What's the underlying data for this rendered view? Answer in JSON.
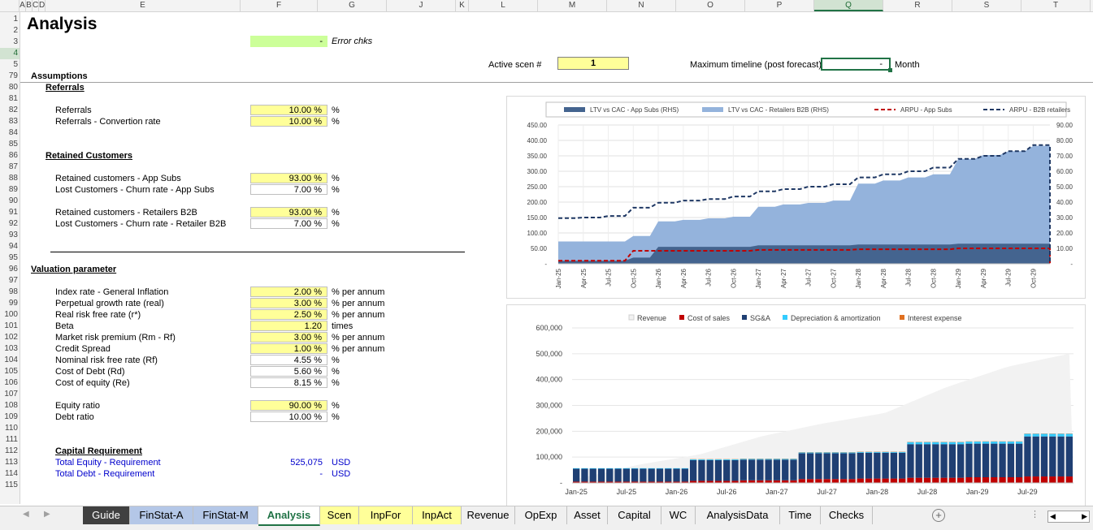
{
  "columns": [
    {
      "label": "A"
    },
    {
      "label": "B"
    },
    {
      "label": "C"
    },
    {
      "label": "D"
    },
    {
      "label": "E"
    },
    {
      "label": "F"
    },
    {
      "label": "G"
    },
    {
      "label": "J"
    },
    {
      "label": "K"
    },
    {
      "label": "L"
    },
    {
      "label": "M"
    },
    {
      "label": "N"
    },
    {
      "label": "O"
    },
    {
      "label": "P"
    },
    {
      "label": "Q"
    },
    {
      "label": "R"
    },
    {
      "label": "S"
    },
    {
      "label": "T"
    }
  ],
  "rows": [
    "1",
    "2",
    "3",
    "4",
    "5",
    "79",
    "80",
    "81",
    "82",
    "83",
    "84",
    "85",
    "86",
    "87",
    "88",
    "89",
    "90",
    "91",
    "92",
    "93",
    "94",
    "95",
    "96",
    "97",
    "98",
    "99",
    "100",
    "101",
    "102",
    "103",
    "104",
    "105",
    "106",
    "107",
    "108",
    "109",
    "110",
    "111",
    "112",
    "113",
    "114",
    "115"
  ],
  "header": {
    "title": "Analysis",
    "error_value": "-",
    "error_label": "Error chks",
    "active_scen_label": "Active scen #",
    "active_scen_value": "1",
    "max_timeline_label": "Maximum timeline (post forecast)",
    "max_timeline_value": "-",
    "month_label": "Month"
  },
  "assumptions": {
    "title": "Assumptions",
    "referrals_title": "Referrals",
    "referrals": [
      {
        "label": "Referrals",
        "value": "10.00 %",
        "unit": "%"
      },
      {
        "label": "Referrals - Convertion rate",
        "value": "10.00 %",
        "unit": "%"
      }
    ],
    "retained_title": "Retained Customers",
    "retained": [
      {
        "label": "Retained customers - App Subs",
        "value": "93.00 %",
        "unit": "%"
      },
      {
        "label": "Lost Customers - Churn rate - App Subs",
        "value": "7.00 %",
        "unit": "%"
      },
      {
        "label": "Retained customers - Retailers B2B",
        "value": "93.00 %",
        "unit": "%"
      },
      {
        "label": "Lost Customers - Churn rate - Retailer B2B",
        "value": "7.00 %",
        "unit": "%"
      }
    ]
  },
  "valuation": {
    "title": "Valuation parameter",
    "items": [
      {
        "label": "Index rate - General Inflation",
        "value": "2.00 %",
        "unit": "% per annum"
      },
      {
        "label": "Perpetual growth rate (real)",
        "value": "3.00 %",
        "unit": "% per annum"
      },
      {
        "label": "Real risk free rate (r*)",
        "value": "2.50 %",
        "unit": "% per annum"
      },
      {
        "label": "Beta",
        "value": "1.20",
        "unit": "times"
      },
      {
        "label": "Market risk premium (Rm - Rf)",
        "value": "3.00 %",
        "unit": "% per annum"
      },
      {
        "label": "Credit Spread",
        "value": "1.00 %",
        "unit": "% per annum"
      },
      {
        "label": "Nominal risk free rate (Rf)",
        "value": "4.55 %",
        "unit": "%"
      },
      {
        "label": "Cost of Debt (Rd)",
        "value": "5.60 %",
        "unit": "%"
      },
      {
        "label": "Cost of equity (Re)",
        "value": "8.15 %",
        "unit": "%"
      },
      {
        "label": "Equity ratio",
        "value": "90.00 %",
        "unit": "%"
      },
      {
        "label": "Debt ratio",
        "value": "10.00 %",
        "unit": "%"
      }
    ]
  },
  "capital": {
    "title": "Capital Requirement",
    "items": [
      {
        "label": "Total Equity - Requirement",
        "value": "525,075",
        "unit": "USD"
      },
      {
        "label": "Total Debt - Requirement",
        "value": "-",
        "unit": "USD"
      }
    ]
  },
  "tabs": [
    {
      "label": "Guide",
      "color": "#404040",
      "text": "#ffffff"
    },
    {
      "label": "FinStat-A",
      "color": "#b4c7e7",
      "text": "#000000"
    },
    {
      "label": "FinStat-M",
      "color": "#b4c7e7",
      "text": "#000000"
    },
    {
      "label": "Analysis",
      "color": "#ffffff",
      "text": "#217346"
    },
    {
      "label": "Scen",
      "color": "#ffff99",
      "text": "#000000"
    },
    {
      "label": "InpFor",
      "color": "#ffff99",
      "text": "#000000"
    },
    {
      "label": "InpAct",
      "color": "#ffff99",
      "text": "#000000"
    },
    {
      "label": "Revenue",
      "color": "#f0f0f0",
      "text": "#000000"
    },
    {
      "label": "OpExp",
      "color": "#f0f0f0",
      "text": "#000000"
    },
    {
      "label": "Asset",
      "color": "#f0f0f0",
      "text": "#000000"
    },
    {
      "label": "Capital",
      "color": "#f0f0f0",
      "text": "#000000"
    },
    {
      "label": "WC",
      "color": "#f0f0f0",
      "text": "#000000"
    },
    {
      "label": "AnalysisData",
      "color": "#f0f0f0",
      "text": "#000000"
    },
    {
      "label": "Time",
      "color": "#f0f0f0",
      "text": "#000000"
    },
    {
      "label": "Checks",
      "color": "#f0f0f0",
      "text": "#000000"
    }
  ],
  "chart_data": [
    {
      "type": "area",
      "legend": [
        "LTV vs CAC - App Subs (RHS)",
        "LTV vs CAC - Retailers B2B (RHS)",
        "ARPU - App Subs",
        "ARPU - B2B retailers"
      ],
      "legend_position": "top",
      "x_labels": [
        "Jan-25",
        "Apr-25",
        "Jul-25",
        "Oct-25",
        "Jan-26",
        "Apr-26",
        "Jul-26",
        "Oct-26",
        "Jan-27",
        "Apr-27",
        "Jul-27",
        "Oct-27",
        "Jan-28",
        "Apr-28",
        "Jul-28",
        "Oct-28",
        "Jan-29",
        "Apr-29",
        "Jul-29",
        "Oct-29"
      ],
      "y_left_ticks": [
        "450.00",
        "400.00",
        "350.00",
        "300.00",
        "250.00",
        "200.00",
        "150.00",
        "100.00",
        "50.00",
        "-"
      ],
      "y_right_ticks": [
        "90.00",
        "80.00",
        "70.00",
        "60.00",
        "50.00",
        "40.00",
        "30.00",
        "20.00",
        "10.00",
        "-"
      ],
      "ylim_left": [
        0,
        450
      ],
      "ylim_right": [
        0,
        90
      ],
      "colors": {
        "app_subs_ltv": "#44648f",
        "retail_ltv": "#94b3dc",
        "arpu_app": "#c00000",
        "arpu_b2b": "#1f3864"
      },
      "series": [
        {
          "name": "LTV vs CAC - App Subs (RHS)",
          "axis": "right",
          "values": [
            2,
            2,
            2,
            4,
            11,
            11,
            11,
            11,
            12,
            12,
            12,
            12,
            12.5,
            12.5,
            12.5,
            12.5,
            13,
            13,
            13,
            13
          ]
        },
        {
          "name": "LTV vs CAC - Retailers B2B (RHS)",
          "axis": "right",
          "values": [
            14.5,
            14.5,
            14.5,
            18,
            27.5,
            28.5,
            29.5,
            30.5,
            37,
            38.5,
            39.5,
            41,
            52,
            54,
            56,
            58,
            68,
            70.5,
            73,
            76.5
          ]
        },
        {
          "name": "ARPU - App Subs",
          "axis": "left",
          "values": [
            10,
            10,
            10,
            42,
            42,
            42,
            42,
            42,
            45,
            45,
            45,
            45,
            47,
            47,
            47,
            47,
            50,
            50,
            50,
            50
          ]
        },
        {
          "name": "ARPU - B2B retailers",
          "axis": "left",
          "values": [
            148,
            150,
            155,
            182,
            198,
            205,
            210,
            218,
            235,
            242,
            250,
            258,
            280,
            290,
            300,
            312,
            340,
            350,
            365,
            385
          ]
        }
      ]
    },
    {
      "type": "bar",
      "legend": [
        "Revenue",
        "Cost of sales",
        "SG&A",
        "Depreciation & amortization",
        "Interest expense"
      ],
      "legend_position": "top",
      "x_labels": [
        "Jan-25",
        "Jul-25",
        "Jan-26",
        "Jul-26",
        "Jan-27",
        "Jul-27",
        "Jan-28",
        "Jul-28",
        "Jan-29",
        "Jul-29"
      ],
      "y_ticks": [
        "600,000",
        "500,000",
        "400,000",
        "300,000",
        "200,000",
        "100,000",
        "-"
      ],
      "ylim": [
        0,
        600000
      ],
      "colors": {
        "revenue": "#f2f2f2",
        "cost_of_sales": "#c00000",
        "sga": "#1f3f73",
        "dep": "#33ccff",
        "interest": "#e07020"
      },
      "months": 60,
      "series": [
        {
          "name": "Revenue",
          "values": [
            15000,
            70000,
            110000,
            180000,
            230000,
            270000,
            370000,
            450000,
            500000
          ]
        },
        {
          "name": "Cost of sales",
          "values": [
            5000,
            5000,
            8000,
            10000,
            15000,
            17000,
            20000,
            22000,
            25000
          ]
        },
        {
          "name": "SG&A",
          "values": [
            50000,
            50000,
            80000,
            80000,
            100000,
            100000,
            130000,
            130000,
            155000
          ]
        },
        {
          "name": "Depreciation & amortization",
          "values": [
            2000,
            2000,
            3000,
            3000,
            3000,
            3000,
            8000,
            8000,
            10000
          ]
        },
        {
          "name": "Interest expense",
          "values": [
            0,
            0,
            1000,
            1000,
            1000,
            1000,
            1000,
            1000,
            1000
          ]
        }
      ]
    }
  ]
}
